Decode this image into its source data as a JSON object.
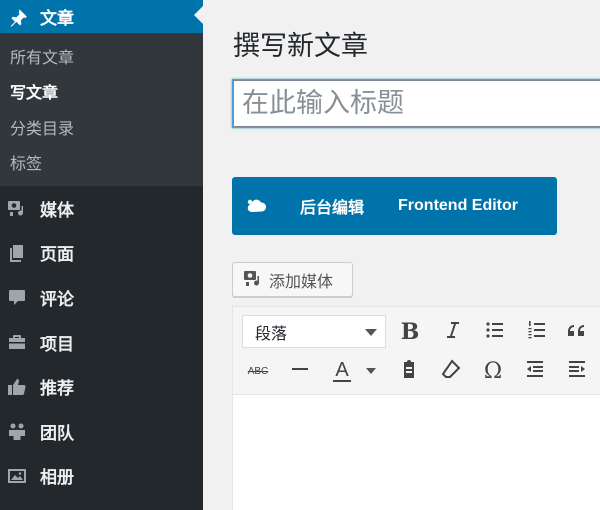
{
  "sidebar": {
    "current": {
      "label": "文章",
      "icon": "pin-icon"
    },
    "submenu": [
      {
        "label": "所有文章",
        "current": false
      },
      {
        "label": "写文章",
        "current": true
      },
      {
        "label": "分类目录",
        "current": false
      },
      {
        "label": "标签",
        "current": false
      }
    ],
    "items": [
      {
        "label": "媒体",
        "icon": "media-icon"
      },
      {
        "label": "页面",
        "icon": "pages-icon"
      },
      {
        "label": "评论",
        "icon": "comments-icon"
      },
      {
        "label": "项目",
        "icon": "portfolio-icon"
      },
      {
        "label": "推荐",
        "icon": "thumbs-up-icon"
      },
      {
        "label": "团队",
        "icon": "groups-icon"
      },
      {
        "label": "相册",
        "icon": "gallery-icon"
      }
    ]
  },
  "main": {
    "page_title": "撰写新文章",
    "title_placeholder": "在此输入标题",
    "builder": {
      "backend_label": "后台编辑",
      "frontend_label": "Frontend Editor"
    },
    "add_media_label": "添加媒体",
    "editor": {
      "format_value": "段落",
      "strike_label": "ABC",
      "text_color_label": "A"
    }
  },
  "colors": {
    "accent": "#0073aa",
    "sidebar_bg": "#23282d",
    "submenu_bg": "#32373c"
  }
}
